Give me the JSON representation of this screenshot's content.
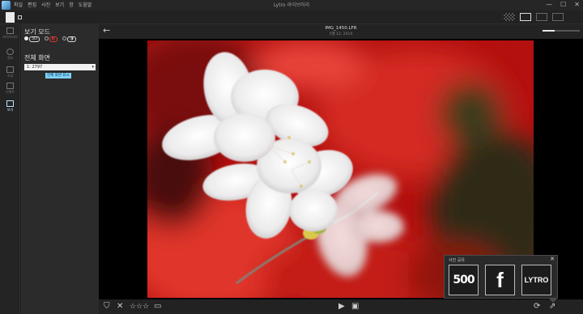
{
  "menu": [
    "파일",
    "편집",
    "사진",
    "보기",
    "창",
    "도움말"
  ],
  "window_title": "Lytro 라이브러리",
  "window_controls": {
    "minimize": "—",
    "maximize": "☐",
    "close": "✕"
  },
  "rail": [
    {
      "label": "라이브러리"
    },
    {
      "label": "정보"
    },
    {
      "label": "조정"
    },
    {
      "label": "이펙트"
    },
    {
      "label": "보기"
    }
  ],
  "panel": {
    "view_mode_title": "보기 모드",
    "modes": [
      "3D",
      "◐",
      "◑"
    ],
    "fullscreen_title": "전체 화면",
    "display_select": "1: 2797",
    "fullscreen_button": "전체 화면 표시"
  },
  "viewer": {
    "back": "←",
    "file_name": "IMG_1450.LFR",
    "file_date": "5월 12, 2014"
  },
  "bottom": {
    "flag": "⛉",
    "reject": "✕",
    "stars": "☆☆☆",
    "comment": "▭",
    "play": "▶",
    "slideshow": "▣",
    "refresh": "⟳",
    "share": "⇗",
    "zoom_level": 0.33
  },
  "share": {
    "title": "사진 공유",
    "close": "✕",
    "services": [
      "500",
      "f",
      "LYTRO"
    ]
  }
}
